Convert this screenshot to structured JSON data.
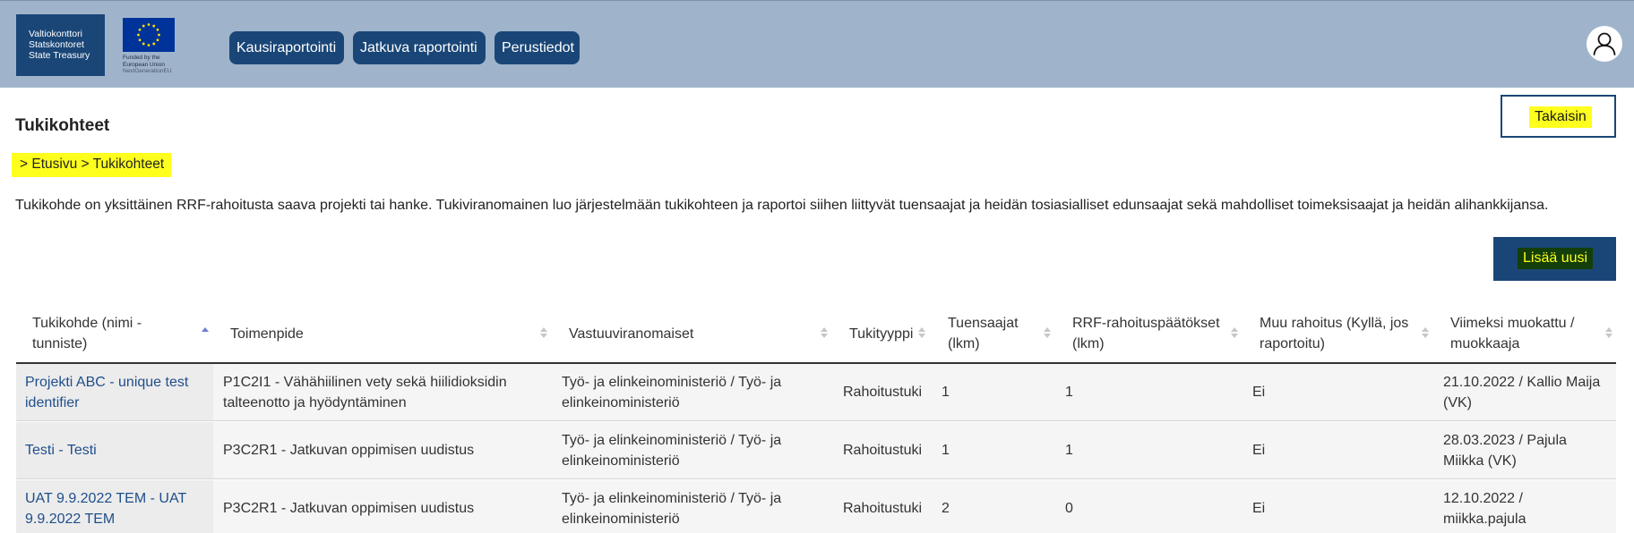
{
  "header": {
    "treasury_logo": [
      "Valtiokonttori",
      "Statskontoret",
      "State Treasury"
    ],
    "eu_logo": [
      "Funded by the",
      "European Union",
      "NextGenerationEU"
    ],
    "nav": [
      "Kausiraportointi",
      "Jatkuva raportointi",
      "Perustiedot"
    ],
    "user_icon": "user-icon"
  },
  "page": {
    "title": "Tukikohteet",
    "back_label": "Takaisin",
    "breadcrumb": {
      "prefix": "> ",
      "home": "Etusivu",
      "sep": " > ",
      "current": "Tukikohteet"
    },
    "intro": "Tukikohde on yksittäinen RRF-rahoitusta saava projekti tai hanke. Tukiviranomainen luo järjestelmään tukikohteen ja raportoi siihen liittyvät tuensaajat ja heidän tosiasialliset edunsaajat sekä mahdolliset toimeksisaajat ja heidän alihankkijansa.",
    "add_label": "Lisää uusi"
  },
  "colors": {
    "header_bg": "#9fb4cb",
    "brand_blue": "#1a4677",
    "highlight": "#ffff1e",
    "link": "#1f4e8a",
    "sort_active": "#6d7dcf"
  },
  "table": {
    "columns": [
      [
        "Tukikohde (nimi -",
        "tunniste)"
      ],
      [
        "Toimenpide"
      ],
      [
        "Vastuuviranomaiset"
      ],
      [
        "Tukityyppi"
      ],
      [
        "Tuensaajat",
        "(lkm)"
      ],
      [
        "RRF-rahoituspäätökset",
        "(lkm)"
      ],
      [
        "Muu rahoitus (Kyllä, jos",
        "raportoitu)"
      ],
      [
        "Viimeksi muokattu /",
        "muokkaaja"
      ]
    ],
    "rows": [
      [
        [
          "Projekti ABC - unique test",
          "identifier"
        ],
        [
          "P1C2I1 - Vähähiilinen vety sekä hiilidioksidin",
          "talteenotto ja hyödyntäminen"
        ],
        [
          "Työ- ja elinkeinoministeriö / Työ- ja",
          "elinkeinoministeriö"
        ],
        [
          "Rahoitustuki"
        ],
        [
          "1"
        ],
        [
          "1"
        ],
        [
          "Ei"
        ],
        [
          "21.10.2022 / Kallio Maija",
          "(VK)"
        ]
      ],
      [
        [
          "Testi - Testi"
        ],
        [
          "P3C2R1 - Jatkuvan oppimisen uudistus"
        ],
        [
          "Työ- ja elinkeinoministeriö / Työ- ja",
          "elinkeinoministeriö"
        ],
        [
          "Rahoitustuki"
        ],
        [
          "1"
        ],
        [
          "1"
        ],
        [
          "Ei"
        ],
        [
          "28.03.2023 / Pajula",
          "Miikka (VK)"
        ]
      ],
      [
        [
          "UAT 9.9.2022 TEM - UAT",
          "9.9.2022 TEM"
        ],
        [
          "P3C2R1 - Jatkuvan oppimisen uudistus"
        ],
        [
          "Työ- ja elinkeinoministeriö / Työ- ja",
          "elinkeinoministeriö"
        ],
        [
          "Rahoitustuki"
        ],
        [
          "2"
        ],
        [
          "0"
        ],
        [
          "Ei"
        ],
        [
          "12.10.2022 /",
          "miikka.pajula"
        ]
      ]
    ]
  }
}
